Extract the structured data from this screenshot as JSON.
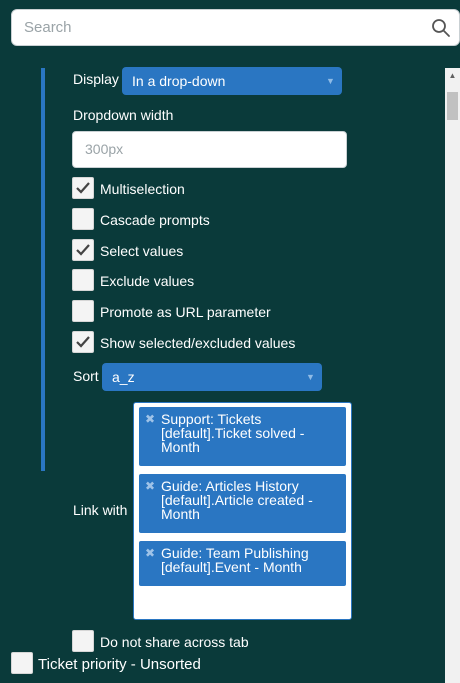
{
  "search": {
    "placeholder": "Search"
  },
  "display": {
    "label": "Display",
    "value": "In a drop-down"
  },
  "dropdown_width": {
    "label": "Dropdown width",
    "placeholder": "300px"
  },
  "options": [
    {
      "label": "Multiselection",
      "checked": true
    },
    {
      "label": "Cascade prompts",
      "checked": false
    },
    {
      "label": "Select values",
      "checked": true
    },
    {
      "label": "Exclude values",
      "checked": false
    },
    {
      "label": "Promote as URL parameter",
      "checked": false
    },
    {
      "label": "Show selected/excluded values",
      "checked": true
    }
  ],
  "sort": {
    "label": "Sort",
    "value": "a_z"
  },
  "link_with": {
    "label": "Link with",
    "tags": [
      {
        "lines": [
          "Support: Tickets",
          "[default].Ticket solved -",
          "Month"
        ]
      },
      {
        "lines": [
          "Guide: Articles History",
          "[default].Article created -",
          "Month"
        ]
      },
      {
        "lines": [
          "Guide: Team Publishing",
          "[default].Event - Month"
        ]
      }
    ]
  },
  "share": {
    "label": "Do not share across tab",
    "checked": false
  },
  "next_item": {
    "label": "Ticket priority - Unsorted",
    "checked": false
  },
  "colors": {
    "background": "#0a3a3a",
    "accent": "#2a76c2"
  }
}
